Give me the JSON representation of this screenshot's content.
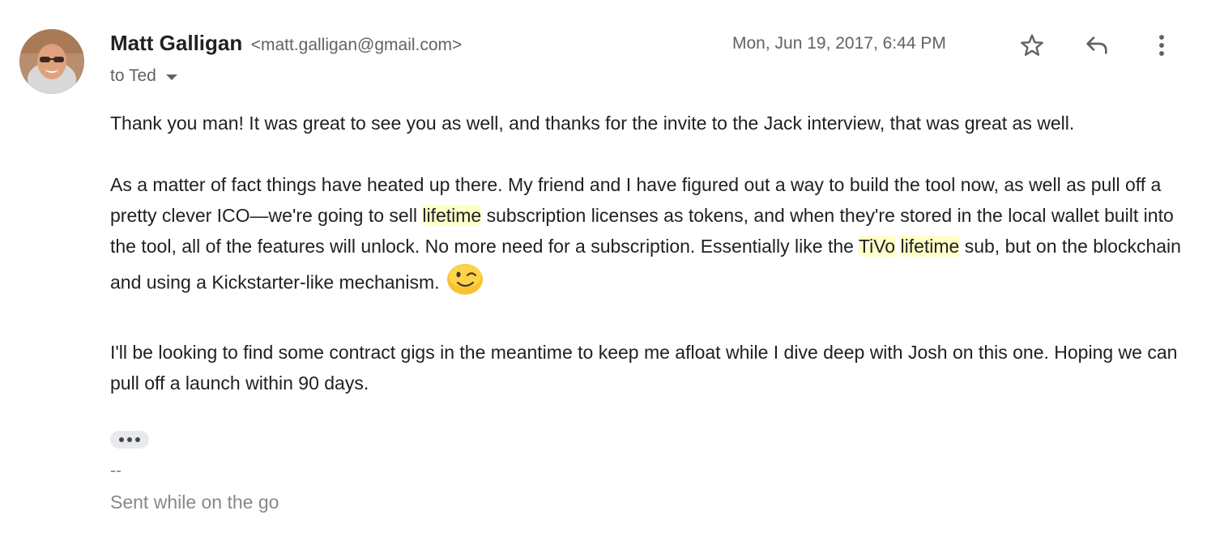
{
  "sender": {
    "name": "Matt Galligan",
    "email": "<matt.galligan@gmail.com>",
    "avatar_icon": "avatar-photo"
  },
  "recipient": {
    "label": "to Ted",
    "icon": "chevron-down-icon"
  },
  "date": "Mon, Jun 19, 2017, 6:44 PM",
  "actions": {
    "star_icon": "star-icon",
    "reply_icon": "reply-icon",
    "more_icon": "more-vert-icon"
  },
  "body": {
    "p1": "Thank you man! It was great to see you as well, and thanks for the invite to the Jack interview, that was great as well.",
    "p2_a": "As a matter of fact things have heated up there. My friend and I have figured out a way to build the tool now, as well as pull off a pretty clever ICO—we're going to sell ",
    "p2_hl1": "lifetime",
    "p2_b": " subscription licenses as tokens, and when they're stored in the local wallet built into the tool, all of the features will unlock. No more need for a subscription. Essentially like the ",
    "p2_hl2": "TiVo",
    "p2_space": " ",
    "p2_hl3": "lifetime",
    "p2_c": " sub, but on the blockchain and using a Kickstarter-like mechanism.",
    "emoji": "winking-face-emoji",
    "p3": "I'll be looking to find some contract gigs in the meantime to keep me afloat while I dive deep with Josh on this one. Hoping we can pull off a launch within 90 days."
  },
  "trimmed_content_icon": "ellipsis-icon",
  "signature": {
    "dash": "--",
    "text": "Sent while on the go"
  },
  "colors": {
    "highlight": "#ffffc8",
    "muted_text": "#5f6368",
    "signature_text": "#888888"
  }
}
